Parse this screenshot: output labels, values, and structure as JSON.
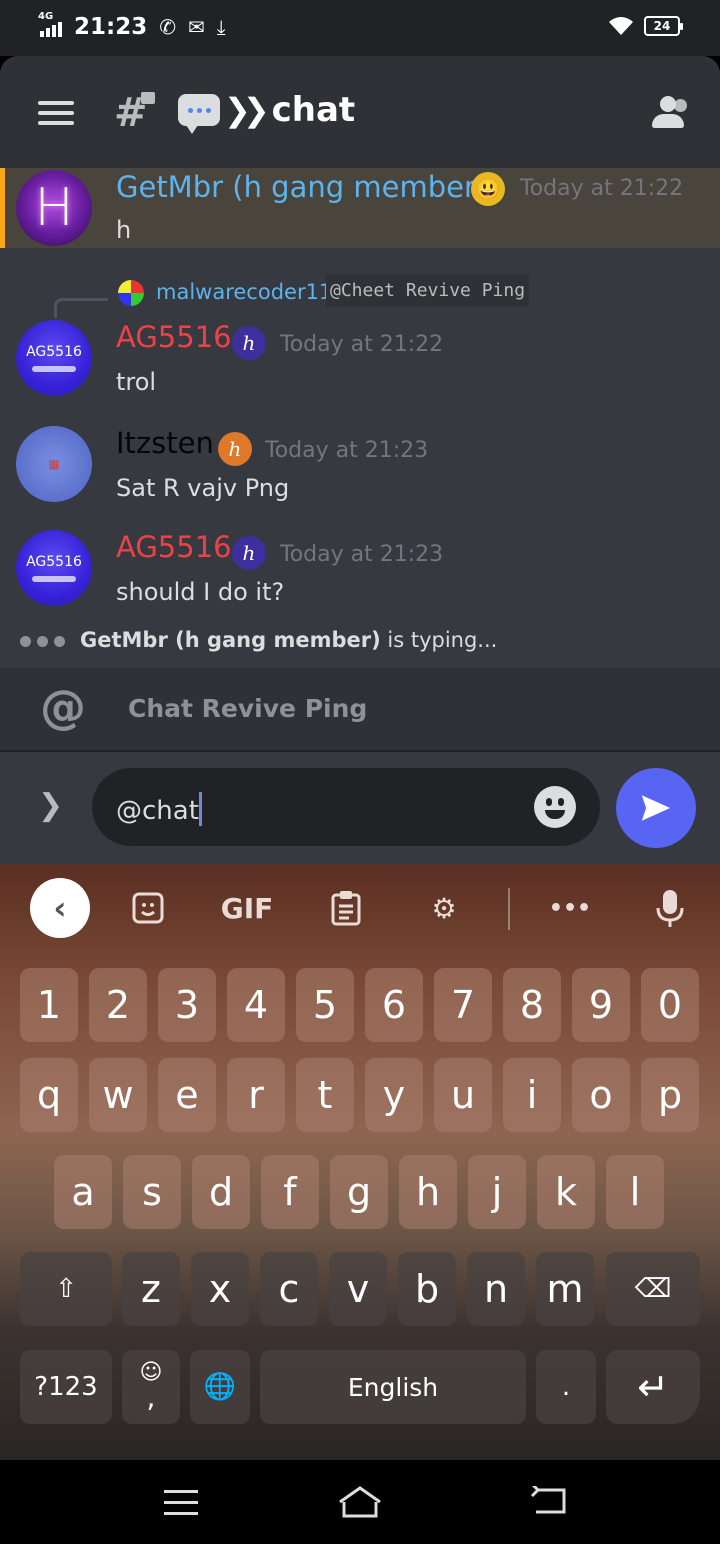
{
  "status_bar": {
    "network": "4G",
    "time": "21:23",
    "icons": [
      "signal-icon",
      "whatsapp-icon",
      "mail-icon",
      "download-icon",
      "wifi-icon",
      "battery-icon"
    ],
    "battery": "24"
  },
  "header": {
    "menu_icon": "hamburger-icon",
    "channel_icon": "locked-hash-icon",
    "channel_name": "chat",
    "members_icon": "members-icon"
  },
  "messages": [
    {
      "author": "GetMbr (h gang member)",
      "author_color": "#5cb4ef",
      "badge": "😃",
      "timestamp": "Today at 21:22",
      "text": "h",
      "avatar_label": "H",
      "highlighted": true
    },
    {
      "reply": {
        "author": "malwarecoder11",
        "text": "@Cheet Revive Ping"
      },
      "author": "AG5516",
      "author_color": "#ed4245",
      "badge": "h",
      "timestamp": "Today at 21:22",
      "text": "trol",
      "avatar_label": "AG5516"
    },
    {
      "author": "Itzsten",
      "author_color": "#060607",
      "badge": "h",
      "timestamp": "Today at 21:23",
      "text": "Sat R vajv Png",
      "avatar_label": "Itzsten avatar"
    },
    {
      "author": "AG5516",
      "author_color": "#ed4245",
      "badge": "h",
      "timestamp": "Today at 21:23",
      "text": "should I do it?",
      "avatar_label": "AG5516"
    }
  ],
  "typing": {
    "user": "GetMbr (h gang member)",
    "suffix": " is typing..."
  },
  "autocomplete": {
    "icon": "at-icon",
    "suggestion": "Chat Revive Ping"
  },
  "composer": {
    "value": "@chat",
    "expand_icon": "chevron-right-icon",
    "emoji_icon": "smiley-icon",
    "send_icon": "send-icon"
  },
  "keyboard": {
    "toolbar": {
      "back": "back-arrow-icon",
      "sticker": "sticker-icon",
      "gif": "GIF",
      "clipboard": "clipboard-icon",
      "settings": "gear-icon",
      "more": "•••",
      "mic": "microphone-icon"
    },
    "number_row": [
      "1",
      "2",
      "3",
      "4",
      "5",
      "6",
      "7",
      "8",
      "9",
      "0"
    ],
    "row1": [
      "q",
      "w",
      "e",
      "r",
      "t",
      "y",
      "u",
      "i",
      "o",
      "p"
    ],
    "row2": [
      "a",
      "s",
      "d",
      "f",
      "g",
      "h",
      "j",
      "k",
      "l"
    ],
    "row3": [
      "z",
      "x",
      "c",
      "v",
      "b",
      "n",
      "m"
    ],
    "symbols_key": "?123",
    "comma_key": ",",
    "space_label": "English",
    "period_key": "."
  },
  "colors": {
    "accent": "#5865f2",
    "highlight_bar": "#faa61a",
    "enter_key": "#5b8ff0"
  }
}
